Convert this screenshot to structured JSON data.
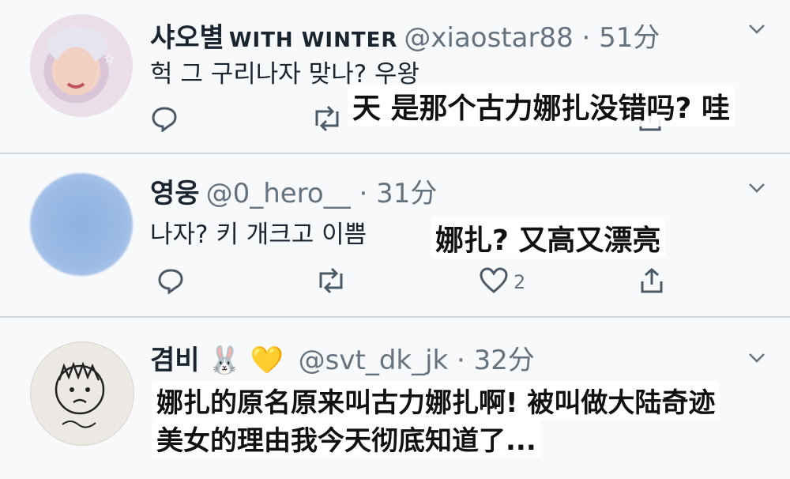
{
  "tweets": [
    {
      "name": "샤오별",
      "name_extra": "WITH WINTER",
      "handle": "@xiaostar88 · 51分",
      "text": "헉 그 구리나자 맞나? 우왕",
      "subtitle": "天 是那个古力娜扎没错吗? 哇"
    },
    {
      "name": "영웅",
      "handle": "@0_hero__ · 31分",
      "text": "나자? 키 개크고 이쁨",
      "likes": "2",
      "subtitle": "娜扎? 又高又漂亮"
    },
    {
      "name": "겸비",
      "emoji": "🐰 💛",
      "handle": "@svt_dk_jk · 32分",
      "subtitle_line1": "娜扎的原名原来叫古力娜扎啊! 被叫做大陆奇迹",
      "subtitle_line2": "美女的理由我今天彻底知道了..."
    }
  ],
  "colors": {
    "accent": "#1da1f2",
    "icon": "#4b5a66",
    "bg": "#f7f9fb"
  }
}
